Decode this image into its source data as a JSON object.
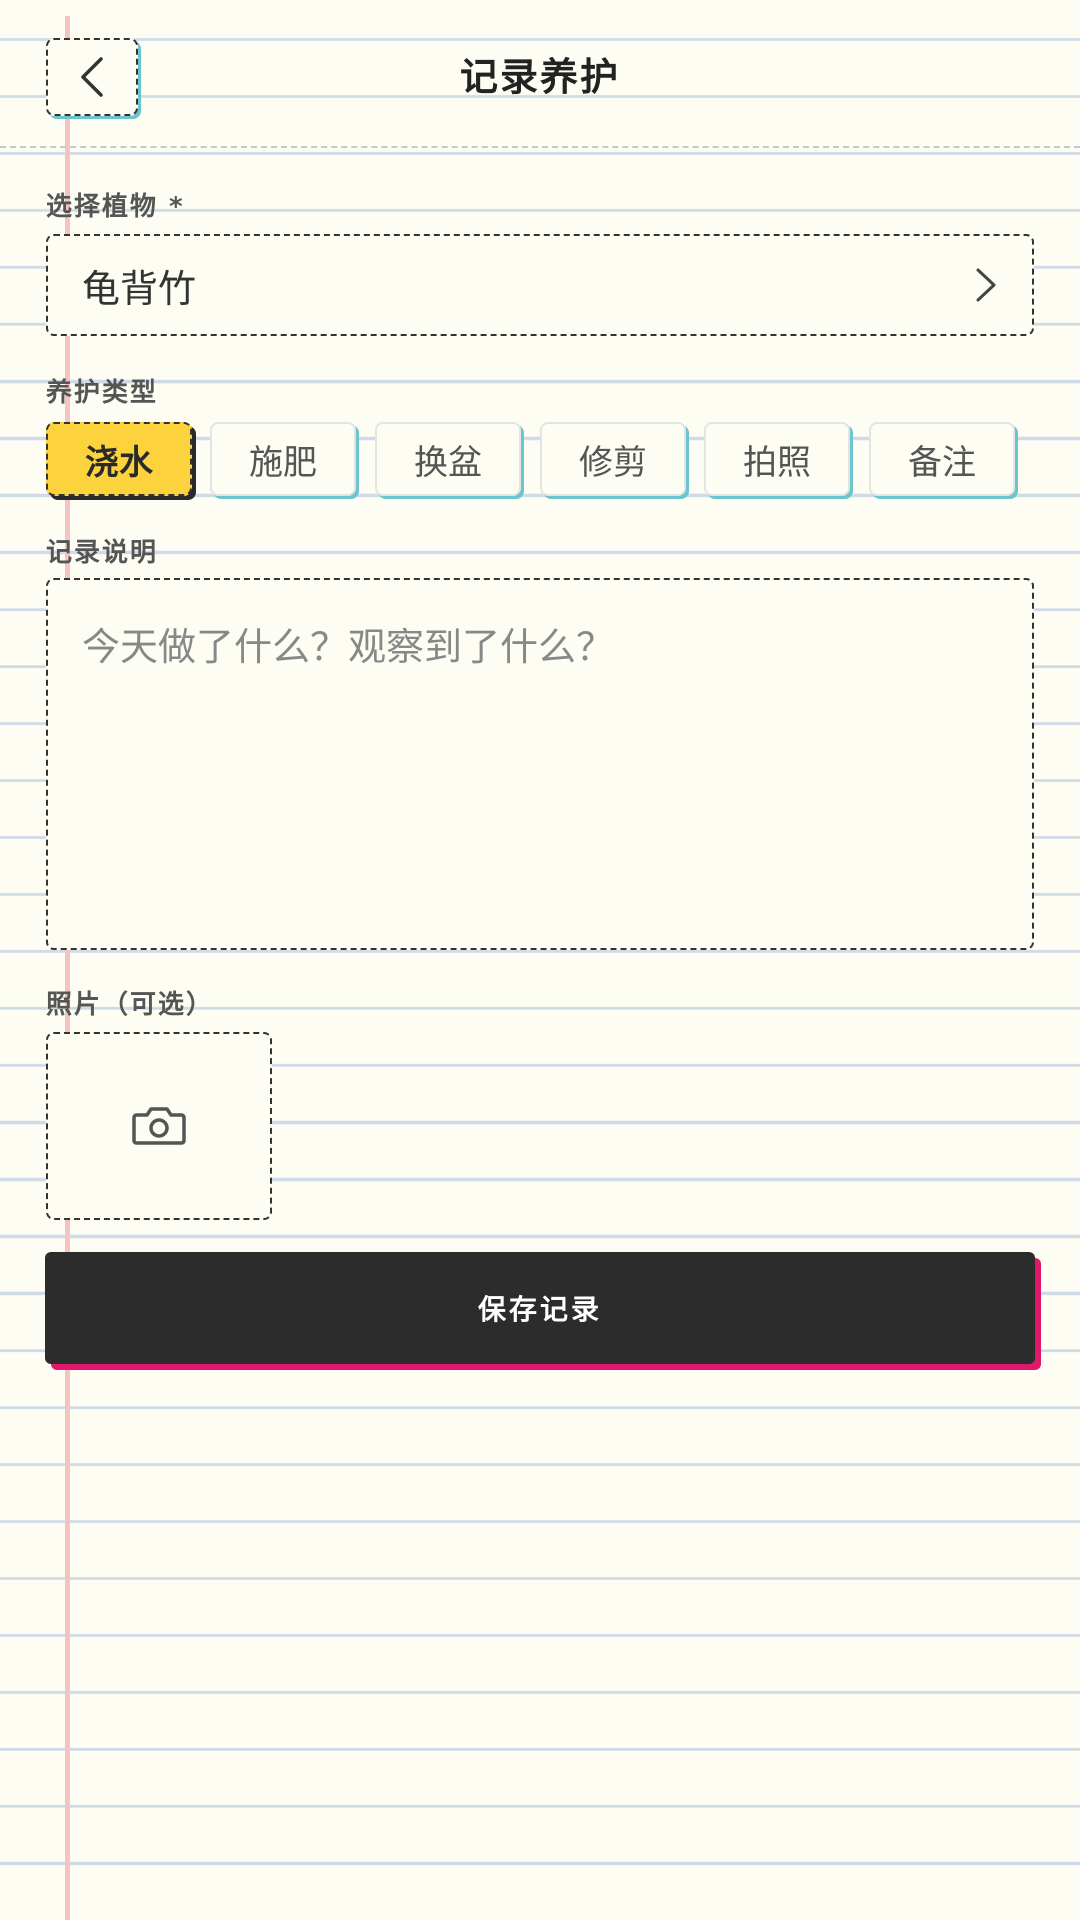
{
  "header": {
    "title": "记录养护"
  },
  "plant": {
    "label": "选择植物 *",
    "value": "龟背竹"
  },
  "care_type": {
    "label": "养护类型",
    "options": [
      "浇水",
      "施肥",
      "换盆",
      "修剪",
      "拍照",
      "备注"
    ],
    "selected": "浇水"
  },
  "note": {
    "label": "记录说明",
    "placeholder": "今天做了什么？观察到了什么？",
    "value": ""
  },
  "photo": {
    "label": "照片（可选）"
  },
  "actions": {
    "save_label": "保存记录"
  },
  "colors": {
    "accent_yellow": "#fcd33c",
    "accent_teal": "#6cc4cc",
    "accent_pink": "#e0186c",
    "button_dark": "#2c2c2c",
    "paper": "#fdfdf4"
  }
}
